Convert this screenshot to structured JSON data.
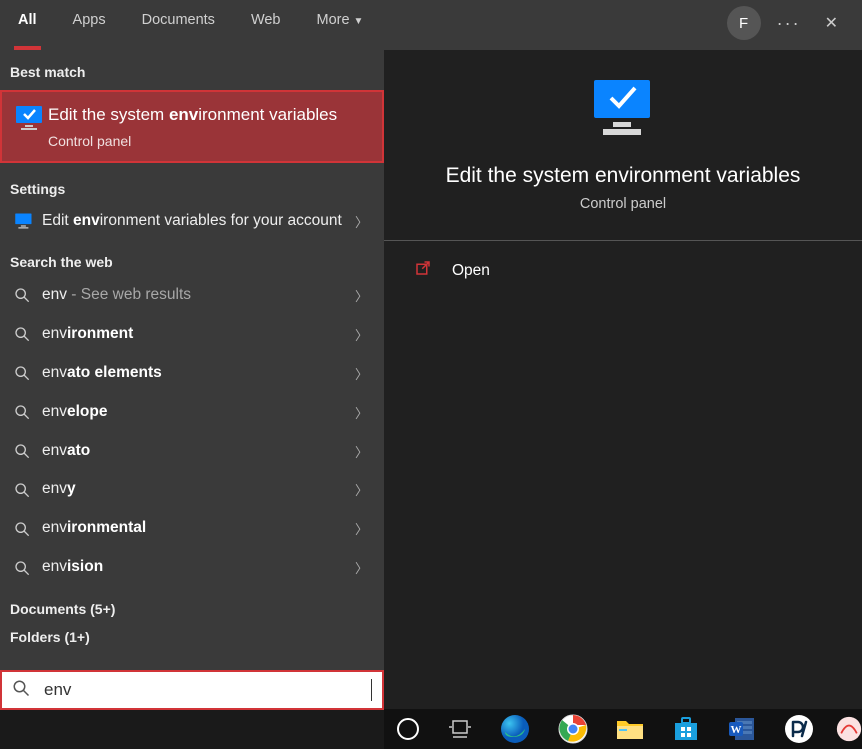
{
  "tabs": {
    "all": "All",
    "apps": "Apps",
    "documents": "Documents",
    "web": "Web",
    "more": "More"
  },
  "user_initial": "F",
  "left": {
    "best_match_header": "Best match",
    "best_match": {
      "title_pre": "Edit the system ",
      "title_bold": "env",
      "title_post": "ironment variables",
      "subtitle": "Control panel"
    },
    "settings_header": "Settings",
    "settings_item": {
      "pre": "Edit ",
      "bold": "env",
      "post": "ironment variables for your account"
    },
    "web_header": "Search the web",
    "web_items": [
      {
        "prefix": "",
        "bold": "env",
        "suffix": "",
        "extra": " - See web results"
      },
      {
        "prefix": "",
        "bold": "env",
        "suffix": "ironment",
        "extra": ""
      },
      {
        "prefix": "",
        "bold": "env",
        "suffix": "ato elements",
        "extra": ""
      },
      {
        "prefix": "",
        "bold": "env",
        "suffix": "elope",
        "extra": ""
      },
      {
        "prefix": "",
        "bold": "env",
        "suffix": "ato",
        "extra": ""
      },
      {
        "prefix": "",
        "bold": "env",
        "suffix": "y",
        "extra": ""
      },
      {
        "prefix": "",
        "bold": "env",
        "suffix": "ironmental",
        "extra": ""
      },
      {
        "prefix": "",
        "bold": "env",
        "suffix": "ision",
        "extra": ""
      }
    ],
    "documents_header": "Documents (5+)",
    "folders_header": "Folders (1+)"
  },
  "right": {
    "title": "Edit the system environment variables",
    "subtitle": "Control panel",
    "open_label": "Open"
  },
  "search": {
    "value": "env"
  }
}
